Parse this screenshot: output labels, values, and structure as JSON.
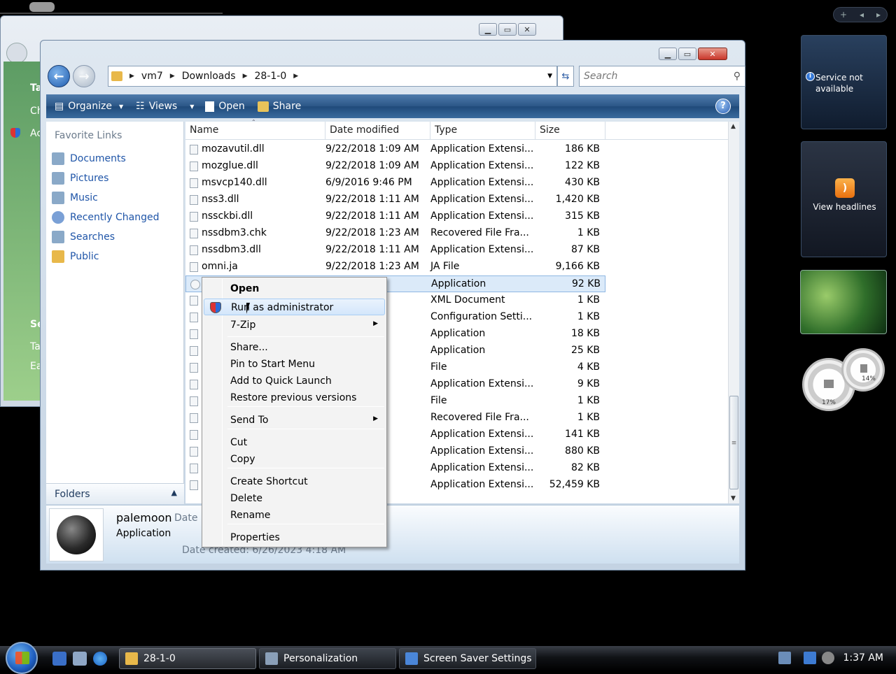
{
  "background_window": {
    "side_texts": [
      "Ta",
      "Ch",
      "Ac",
      "Se",
      "Ta",
      "Ea"
    ]
  },
  "window": {
    "breadcrumbs": [
      "vm7",
      "Downloads",
      "28-1-0"
    ],
    "search_placeholder": "Search",
    "toolbar": {
      "organize": "Organize",
      "views": "Views",
      "open": "Open",
      "share": "Share"
    },
    "favorite_links_header": "Favorite Links",
    "favorite_links": [
      "Documents",
      "Pictures",
      "Music",
      "Recently Changed",
      "Searches",
      "Public"
    ],
    "folders_label": "Folders",
    "columns": [
      "Name",
      "Date modified",
      "Type",
      "Size"
    ],
    "files": [
      {
        "name": "mozavutil.dll",
        "date": "9/22/2018 1:09 AM",
        "type": "Application Extensi...",
        "size": "186 KB"
      },
      {
        "name": "mozglue.dll",
        "date": "9/22/2018 1:09 AM",
        "type": "Application Extensi...",
        "size": "122 KB"
      },
      {
        "name": "msvcp140.dll",
        "date": "6/9/2016 9:46 PM",
        "type": "Application Extensi...",
        "size": "430 KB"
      },
      {
        "name": "nss3.dll",
        "date": "9/22/2018 1:11 AM",
        "type": "Application Extensi...",
        "size": "1,420 KB"
      },
      {
        "name": "nssckbi.dll",
        "date": "9/22/2018 1:11 AM",
        "type": "Application Extensi...",
        "size": "315 KB"
      },
      {
        "name": "nssdbm3.chk",
        "date": "9/22/2018 1:23 AM",
        "type": "Recovered File Fra...",
        "size": "1 KB"
      },
      {
        "name": "nssdbm3.dll",
        "date": "9/22/2018 1:11 AM",
        "type": "Application Extensi...",
        "size": "87 KB"
      },
      {
        "name": "omni.ja",
        "date": "9/22/2018 1:23 AM",
        "type": "JA File",
        "size": "9,166 KB"
      },
      {
        "name": "",
        "date": "09 AM",
        "type": "Application",
        "size": "92 KB"
      },
      {
        "name": "",
        "date": "0:55 PM",
        "type": "XML Document",
        "size": "1 KB"
      },
      {
        "name": "",
        "date": "21 AM",
        "type": "Configuration Setti...",
        "size": "1 KB"
      },
      {
        "name": "",
        "date": "21 AM",
        "type": "Application",
        "size": "18 KB"
      },
      {
        "name": "",
        "date": "08 AM",
        "type": "Application",
        "size": "25 KB"
      },
      {
        "name": "",
        "date": "23 AM",
        "type": "File",
        "size": "4 KB"
      },
      {
        "name": "",
        "date": "21 AM",
        "type": "Application Extensi...",
        "size": "9 KB"
      },
      {
        "name": "",
        "date": "23 AM",
        "type": "File",
        "size": "1 KB"
      },
      {
        "name": "",
        "date": "23 AM",
        "type": "Recovered File Fra...",
        "size": "1 KB"
      },
      {
        "name": "",
        "date": "11 AM",
        "type": "Application Extensi...",
        "size": "141 KB"
      },
      {
        "name": "",
        "date": "3 PM",
        "type": "Application Extensi...",
        "size": "880 KB"
      },
      {
        "name": "",
        "date": "6 PM",
        "type": "Application Extensi...",
        "size": "82 KB"
      },
      {
        "name": "",
        "date": "21 AM",
        "type": "Application Extensi...",
        "size": "52,459 KB"
      }
    ],
    "details": {
      "name": "palemoon",
      "type": "Application",
      "date_label": "Date r",
      "created": "Date created:  6/26/2023 4:18 AM"
    }
  },
  "context_menu": [
    {
      "label": "Open",
      "bold": true
    },
    {
      "label": "Run as administrator",
      "highlighted": true,
      "icon": "shield-icon"
    },
    {
      "label": "7-Zip",
      "submenu": true
    },
    {
      "label": "Share..."
    },
    {
      "label": "Pin to Start Menu"
    },
    {
      "label": "Add to Quick Launch"
    },
    {
      "label": "Restore previous versions"
    },
    {
      "label": "Send To",
      "submenu": true
    },
    {
      "label": "Cut"
    },
    {
      "label": "Copy"
    },
    {
      "label": "Create Shortcut"
    },
    {
      "label": "Delete"
    },
    {
      "label": "Rename"
    },
    {
      "label": "Properties"
    }
  ],
  "gadgets": {
    "weather_text": "Service not available",
    "feed_text": "View headlines",
    "cpu_percent": "17%",
    "mem_percent": "14%"
  },
  "taskbar": {
    "tasks": [
      "28-1-0",
      "Personalization",
      "Screen Saver Settings"
    ],
    "clock": "1:37 AM"
  },
  "colors": {
    "accent": "#1f55a8",
    "toolbar": "#2b5687",
    "selection": "#dbeaf9"
  }
}
